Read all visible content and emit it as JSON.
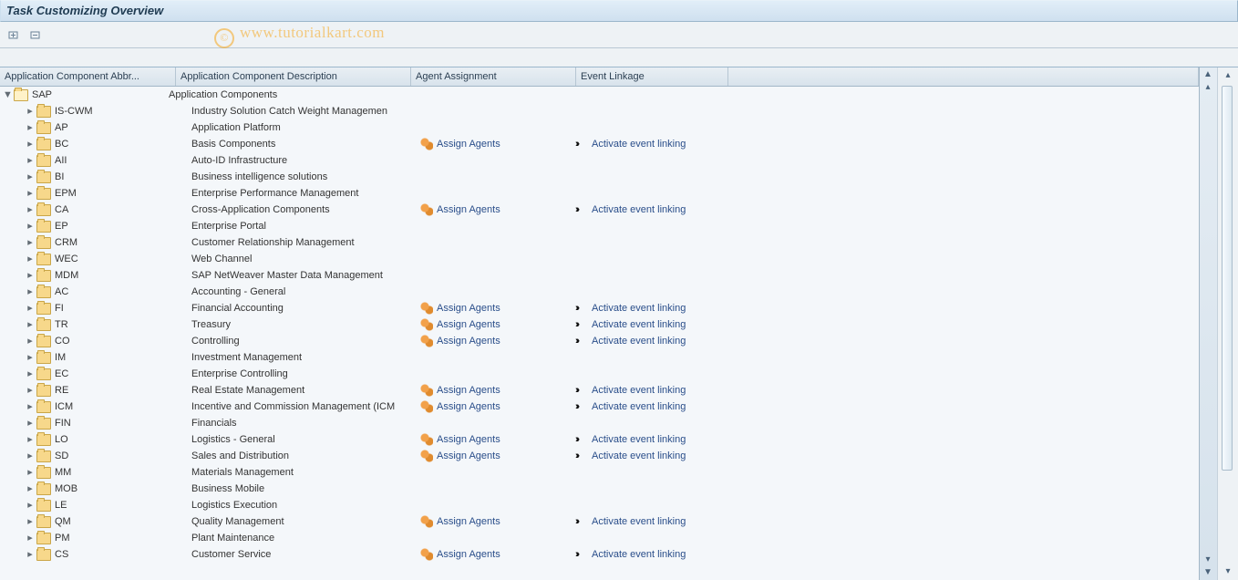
{
  "title": "Task Customizing Overview",
  "watermark": "www.tutorialkart.com",
  "headers": {
    "abbr": "Application Component Abbr...",
    "desc": "Application Component Description",
    "agent": "Agent Assignment",
    "event": "Event Linkage"
  },
  "labels": {
    "assign": "Assign Agents",
    "activate": "Activate event linking"
  },
  "rows": [
    {
      "abbr": "SAP",
      "desc": "Application Components",
      "indent": 0,
      "open": true,
      "agents": false,
      "event": false
    },
    {
      "abbr": "IS-CWM",
      "desc": "Industry Solution Catch Weight Managemen",
      "indent": 1,
      "agents": false,
      "event": false
    },
    {
      "abbr": "AP",
      "desc": "Application Platform",
      "indent": 1,
      "agents": false,
      "event": false
    },
    {
      "abbr": "BC",
      "desc": "Basis Components",
      "indent": 1,
      "agents": true,
      "event": true
    },
    {
      "abbr": "AII",
      "desc": "Auto-ID Infrastructure",
      "indent": 1,
      "agents": false,
      "event": false
    },
    {
      "abbr": "BI",
      "desc": "Business intelligence solutions",
      "indent": 1,
      "agents": false,
      "event": false
    },
    {
      "abbr": "EPM",
      "desc": "Enterprise Performance Management",
      "indent": 1,
      "agents": false,
      "event": false
    },
    {
      "abbr": "CA",
      "desc": "Cross-Application Components",
      "indent": 1,
      "agents": true,
      "event": true
    },
    {
      "abbr": "EP",
      "desc": "Enterprise Portal",
      "indent": 1,
      "agents": false,
      "event": false
    },
    {
      "abbr": "CRM",
      "desc": "Customer Relationship Management",
      "indent": 1,
      "agents": false,
      "event": false
    },
    {
      "abbr": "WEC",
      "desc": "Web Channel",
      "indent": 1,
      "agents": false,
      "event": false
    },
    {
      "abbr": "MDM",
      "desc": "SAP NetWeaver Master Data Management",
      "indent": 1,
      "agents": false,
      "event": false
    },
    {
      "abbr": "AC",
      "desc": "Accounting - General",
      "indent": 1,
      "agents": false,
      "event": false
    },
    {
      "abbr": "FI",
      "desc": "Financial Accounting",
      "indent": 1,
      "agents": true,
      "event": true
    },
    {
      "abbr": "TR",
      "desc": "Treasury",
      "indent": 1,
      "agents": true,
      "event": true
    },
    {
      "abbr": "CO",
      "desc": "Controlling",
      "indent": 1,
      "agents": true,
      "event": true
    },
    {
      "abbr": "IM",
      "desc": "Investment Management",
      "indent": 1,
      "agents": false,
      "event": false
    },
    {
      "abbr": "EC",
      "desc": "Enterprise Controlling",
      "indent": 1,
      "agents": false,
      "event": false
    },
    {
      "abbr": "RE",
      "desc": "Real Estate Management",
      "indent": 1,
      "agents": true,
      "event": true
    },
    {
      "abbr": "ICM",
      "desc": "Incentive and Commission Management (ICM",
      "indent": 1,
      "agents": true,
      "event": true
    },
    {
      "abbr": "FIN",
      "desc": "Financials",
      "indent": 1,
      "agents": false,
      "event": false
    },
    {
      "abbr": "LO",
      "desc": "Logistics - General",
      "indent": 1,
      "agents": true,
      "event": true
    },
    {
      "abbr": "SD",
      "desc": "Sales and Distribution",
      "indent": 1,
      "agents": true,
      "event": true
    },
    {
      "abbr": "MM",
      "desc": "Materials Management",
      "indent": 1,
      "agents": false,
      "event": false
    },
    {
      "abbr": "MOB",
      "desc": "Business Mobile",
      "indent": 1,
      "agents": false,
      "event": false
    },
    {
      "abbr": "LE",
      "desc": "Logistics Execution",
      "indent": 1,
      "agents": false,
      "event": false
    },
    {
      "abbr": "QM",
      "desc": "Quality Management",
      "indent": 1,
      "agents": true,
      "event": true
    },
    {
      "abbr": "PM",
      "desc": "Plant Maintenance",
      "indent": 1,
      "agents": false,
      "event": false
    },
    {
      "abbr": "CS",
      "desc": "Customer Service",
      "indent": 1,
      "agents": true,
      "event": true
    }
  ]
}
